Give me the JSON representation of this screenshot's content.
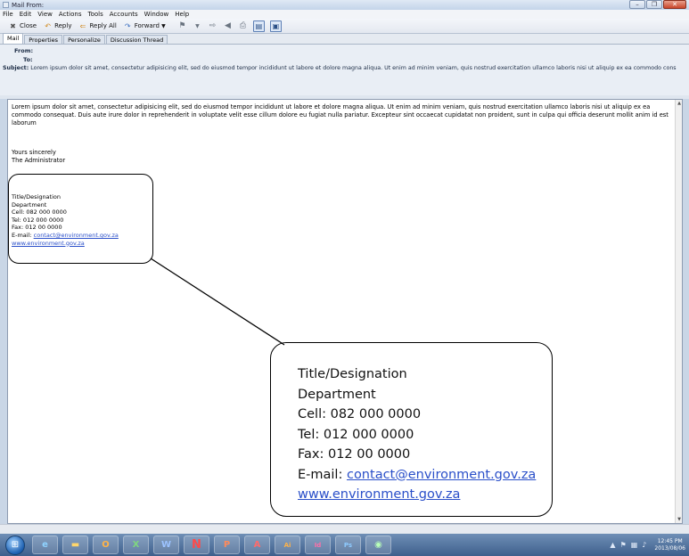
{
  "window": {
    "title": "Mail From:"
  },
  "menu": [
    "File",
    "Edit",
    "View",
    "Actions",
    "Tools",
    "Accounts",
    "Window",
    "Help"
  ],
  "toolbar": {
    "close_label": "Close",
    "reply_label": "Reply",
    "reply_all_label": "Reply All",
    "forward_label": "Forward"
  },
  "tabs": [
    "Mail",
    "Properties",
    "Personalize",
    "Discussion Thread"
  ],
  "header": {
    "from_label": "From:",
    "to_label": "To:",
    "subject_label": "Subject:",
    "subject_text": "Lorem ipsum dolor sit amet, consectetur adipisicing elit, sed do eiusmod tempor incididunt ut labore et dolore magna aliqua. Ut enim ad minim veniam, quis nostrud exercitation ullamco laboris nisi ut aliquip ex ea commodo cons"
  },
  "body": {
    "paragraph": "Lorem ipsum dolor sit amet, consectetur adipisicing elit, sed do eiusmod tempor incididunt ut labore et dolore magna aliqua. Ut enim ad minim veniam, quis nostrud exercitation ullamco laboris nisi ut aliquip ex ea commodo consequat. Duis aute irure dolor in reprehenderit in voluptate velit esse cillum dolore eu fugiat nulla pariatur. Excepteur sint occaecat cupidatat non proident, sunt in culpa qui officia deserunt mollit anim id est laborum",
    "closing_1": "Yours sincerely",
    "closing_2": "The Administrator"
  },
  "signature": {
    "designation": "Title/Designation",
    "department": "Department",
    "cell": "Cell: 082 000 0000",
    "tel": "Tel: 012 000 0000",
    "fax": "Fax: 012 00 0000",
    "email_label": "E-mail: ",
    "email": "contact@environment.gov.za",
    "website": "www.environment.gov.za"
  },
  "taskbar": {
    "clock_time": "12:45 PM",
    "clock_date": "2013/08/06",
    "apps": [
      "ie-icon",
      "explorer-icon",
      "outlook-icon",
      "excel-icon",
      "word-icon",
      "n-app-icon",
      "powerpoint-icon",
      "acrobat-icon",
      "illustrator-icon",
      "indesign-icon",
      "photoshop-icon",
      "chrome-icon"
    ]
  },
  "colors": {
    "link": "#2a4fc9",
    "titlebar": "#c3d4ea",
    "taskbar": "#3e5f8c"
  }
}
